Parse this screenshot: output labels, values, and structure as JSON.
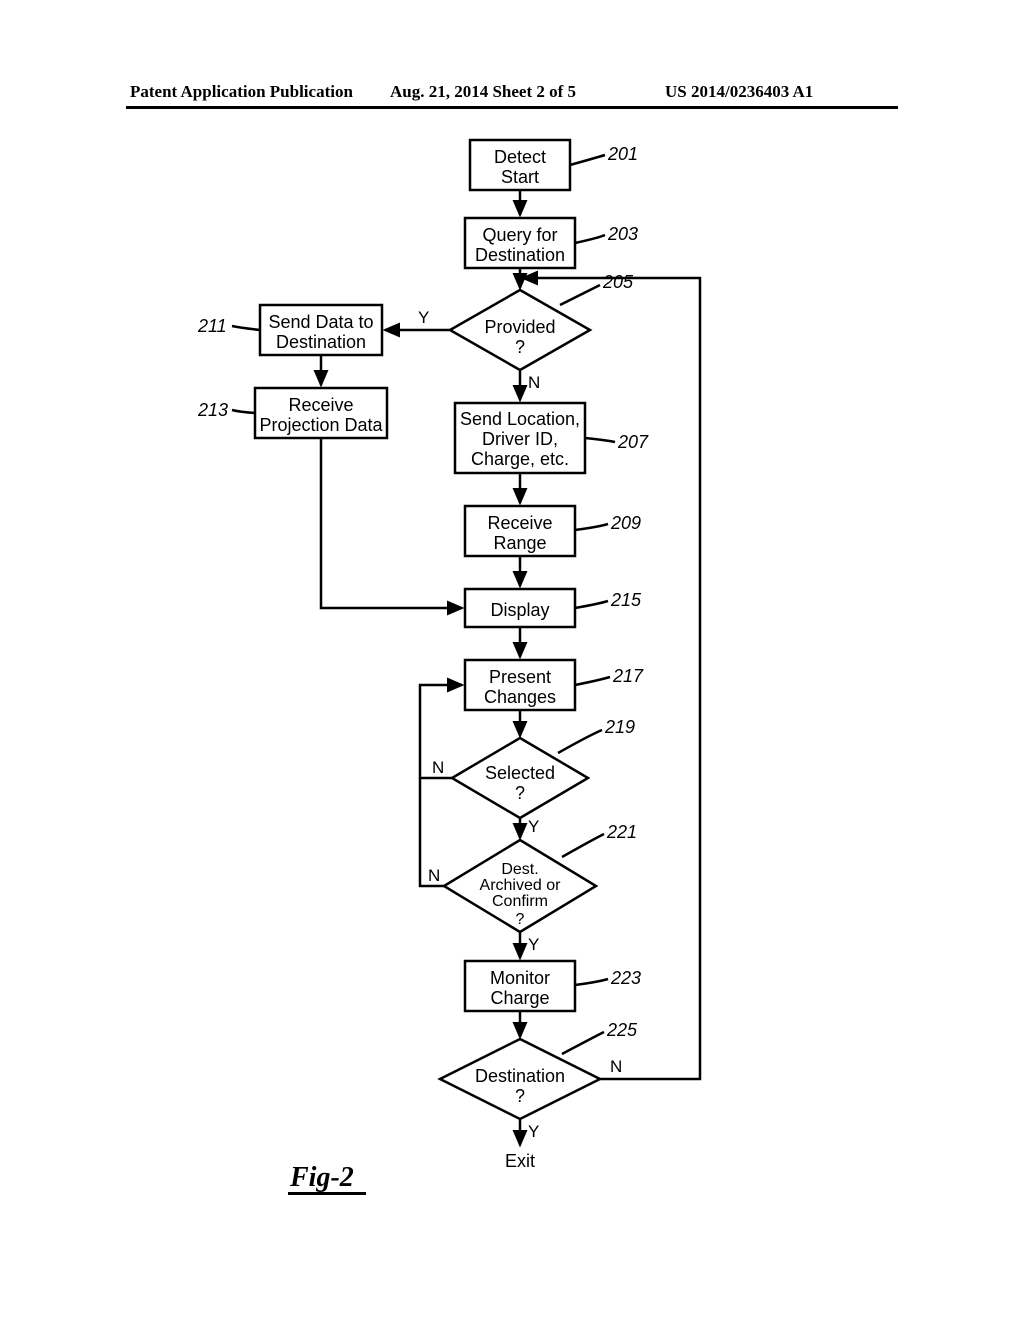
{
  "header": {
    "left": "Patent Application Publication",
    "center": "Aug. 21, 2014  Sheet 2 of 5",
    "right": "US 2014/0236403 A1"
  },
  "figure_caption": "Fig-2",
  "chart_data": {
    "type": "flowchart",
    "title": "Fig-2",
    "nodes": [
      {
        "id": "201",
        "type": "process",
        "text": "Detect Start",
        "ref": "201"
      },
      {
        "id": "203",
        "type": "process",
        "text": "Query for Destination",
        "ref": "203"
      },
      {
        "id": "205",
        "type": "decision",
        "text": "Provided ?",
        "ref": "205"
      },
      {
        "id": "207",
        "type": "process",
        "text": "Send Location, Driver ID, Charge, etc.",
        "ref": "207"
      },
      {
        "id": "209",
        "type": "process",
        "text": "Receive Range",
        "ref": "209"
      },
      {
        "id": "211",
        "type": "process",
        "text": "Send Data to Destination",
        "ref": "211"
      },
      {
        "id": "213",
        "type": "process",
        "text": "Receive Projection Data",
        "ref": "213"
      },
      {
        "id": "215",
        "type": "process",
        "text": "Display",
        "ref": "215"
      },
      {
        "id": "217",
        "type": "process",
        "text": "Present Changes",
        "ref": "217"
      },
      {
        "id": "219",
        "type": "decision",
        "text": "Selected ?",
        "ref": "219"
      },
      {
        "id": "221",
        "type": "decision",
        "text": "Dest. Archived or Confirm ?",
        "ref": "221"
      },
      {
        "id": "223",
        "type": "process",
        "text": "Monitor Charge",
        "ref": "223"
      },
      {
        "id": "225",
        "type": "decision",
        "text": "Destination ?",
        "ref": "225"
      },
      {
        "id": "exit",
        "type": "terminator",
        "text": "Exit"
      }
    ],
    "edges": [
      {
        "from": "201",
        "to": "203"
      },
      {
        "from": "203",
        "to": "205"
      },
      {
        "from": "205",
        "to": "211",
        "label": "Y"
      },
      {
        "from": "205",
        "to": "207",
        "label": "N"
      },
      {
        "from": "207",
        "to": "209"
      },
      {
        "from": "209",
        "to": "215"
      },
      {
        "from": "211",
        "to": "213"
      },
      {
        "from": "213",
        "to": "215"
      },
      {
        "from": "215",
        "to": "217"
      },
      {
        "from": "217",
        "to": "219"
      },
      {
        "from": "219",
        "to": "221",
        "label": "Y"
      },
      {
        "from": "219",
        "to": "217",
        "label": "N"
      },
      {
        "from": "221",
        "to": "223",
        "label": "Y"
      },
      {
        "from": "221",
        "to": "217",
        "label": "N"
      },
      {
        "from": "223",
        "to": "225"
      },
      {
        "from": "225",
        "to": "exit",
        "label": "Y"
      },
      {
        "from": "225",
        "to": "203",
        "label": "N"
      }
    ]
  },
  "boxes": {
    "b201_l1": "Detect",
    "b201_l2": "Start",
    "b203_l1": "Query for",
    "b203_l2": "Destination",
    "b205_l1": "Provided",
    "b205_l2": "?",
    "b207_l1": "Send Location,",
    "b207_l2": "Driver ID,",
    "b207_l3": "Charge, etc.",
    "b209_l1": "Receive",
    "b209_l2": "Range",
    "b211_l1": "Send Data to",
    "b211_l2": "Destination",
    "b213_l1": "Receive",
    "b213_l2": "Projection Data",
    "b215": "Display",
    "b217_l1": "Present",
    "b217_l2": "Changes",
    "b219_l1": "Selected",
    "b219_l2": "?",
    "b221_l1": "Dest.",
    "b221_l2": "Archived or",
    "b221_l3": "Confirm",
    "b221_l4": "?",
    "b223_l1": "Monitor",
    "b223_l2": "Charge",
    "b225_l1": "Destination",
    "b225_l2": "?",
    "exit": "Exit"
  },
  "refs": {
    "r201": "201",
    "r203": "203",
    "r205": "205",
    "r207": "207",
    "r209": "209",
    "r211": "211",
    "r213": "213",
    "r215": "215",
    "r217": "217",
    "r219": "219",
    "r221": "221",
    "r223": "223",
    "r225": "225"
  },
  "paths": {
    "Y": "Y",
    "N": "N"
  }
}
